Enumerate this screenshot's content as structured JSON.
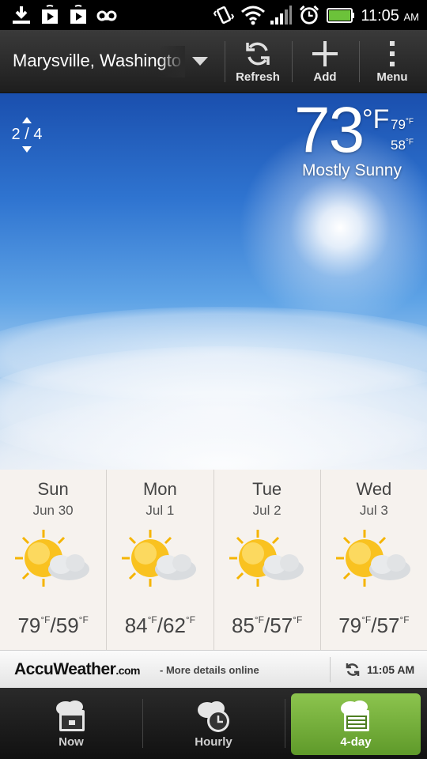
{
  "status_bar": {
    "time": "11:05",
    "ampm": "AM",
    "left_icons": [
      "download-icon",
      "play-store-icon",
      "play-store-icon",
      "voicemail-icon"
    ],
    "right_icons": [
      "vibrate-icon",
      "wifi-icon",
      "signal-icon",
      "alarm-icon",
      "battery-icon"
    ],
    "battery_color": "#6cc23a"
  },
  "action_bar": {
    "location": "Marysville, Washington",
    "refresh_label": "Refresh",
    "add_label": "Add",
    "menu_label": "Menu"
  },
  "current": {
    "page_indicator": "2 / 4",
    "temperature": "73",
    "unit": "°F",
    "high": "79",
    "low": "58",
    "deg_f": "°F",
    "condition": "Mostly Sunny"
  },
  "forecast": [
    {
      "day": "Sun",
      "date": "Jun 30",
      "high": "79",
      "low": "59",
      "icon": "partly-sunny-icon"
    },
    {
      "day": "Mon",
      "date": "Jul 1",
      "high": "84",
      "low": "62",
      "icon": "partly-sunny-icon"
    },
    {
      "day": "Tue",
      "date": "Jul 2",
      "high": "85",
      "low": "57",
      "icon": "partly-sunny-icon"
    },
    {
      "day": "Wed",
      "date": "Jul 3",
      "high": "79",
      "low": "57",
      "icon": "partly-sunny-icon"
    }
  ],
  "footer": {
    "brand": "AccuWeather",
    "brand_suffix": ".com",
    "more": "- More details online",
    "updated_time": "11:05 AM"
  },
  "tabs": [
    {
      "label": "Now",
      "active": false
    },
    {
      "label": "Hourly",
      "active": false
    },
    {
      "label": "4-day",
      "active": true
    }
  ],
  "colors": {
    "active_tab": "#7ab442",
    "forecast_bg": "#f6f2ee",
    "sky_top": "#1a4fae"
  }
}
